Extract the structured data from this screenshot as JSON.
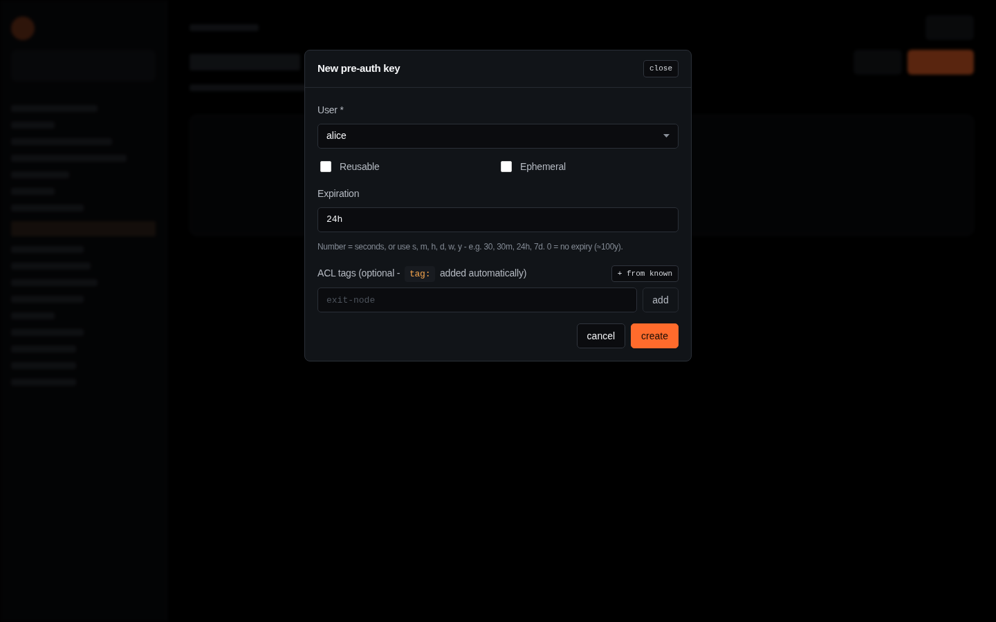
{
  "dialog": {
    "title": "New pre-auth key",
    "close_label": "close"
  },
  "user_field": {
    "label": "User *",
    "value": "alice"
  },
  "options": [
    {
      "label": "Reusable",
      "checked": false
    },
    {
      "label": "Ephemeral",
      "checked": false
    }
  ],
  "expiration": {
    "label": "Expiration",
    "value": "24h",
    "hint": "Number = seconds, or use s, m, h, d, w, y - e.g. 30, 30m, 24h, 7d. 0 = no expiry (≈100y)."
  },
  "acl_tags": {
    "label_before": "ACL tags (optional -",
    "code": "tag:",
    "label_after": "added automatically)",
    "from_known_label": "+ from known",
    "placeholder": "exit-node",
    "add_label": "add"
  },
  "actions": [
    {
      "label": "cancel",
      "kind": "secondary"
    },
    {
      "label": "create",
      "kind": "primary"
    }
  ]
}
